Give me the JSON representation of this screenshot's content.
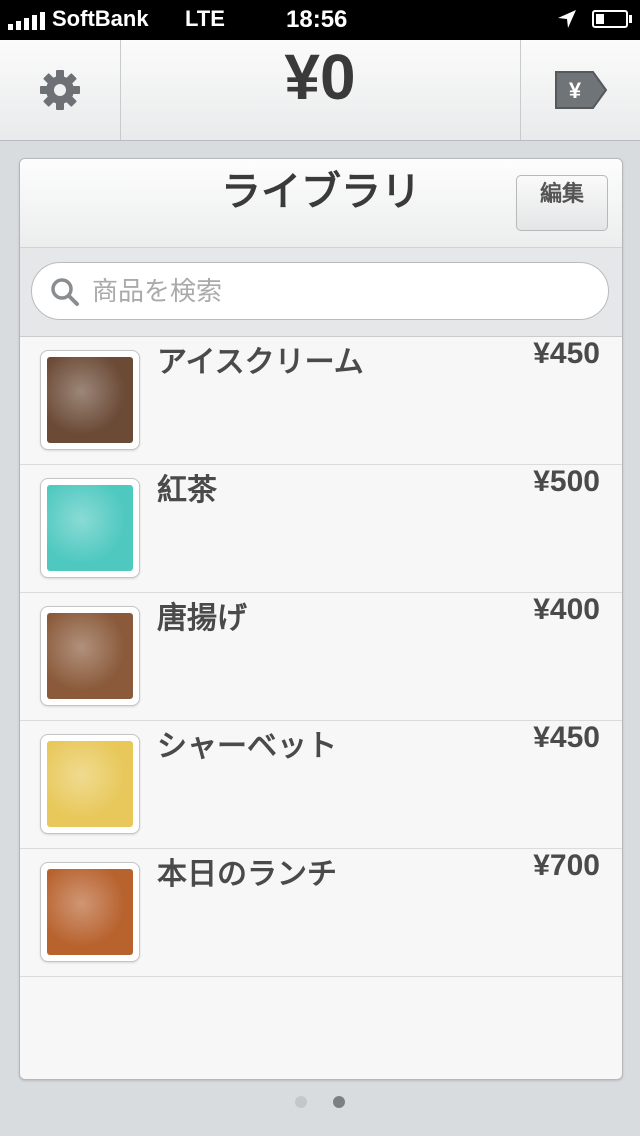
{
  "status_bar": {
    "carrier": "SoftBank",
    "network": "LTE",
    "time": "18:56"
  },
  "header": {
    "total": "¥0",
    "settings_icon": "gear-icon",
    "checkout_icon": "yen-tag-icon",
    "checkout_symbol": "¥"
  },
  "library": {
    "title": "ライブラリ",
    "edit_label": "編集",
    "search_placeholder": "商品を検索",
    "items": [
      {
        "name": "アイスクリーム",
        "price": "¥450",
        "color": "#6b4a36"
      },
      {
        "name": "紅茶",
        "price": "¥500",
        "color": "#4fc9c0"
      },
      {
        "name": "唐揚げ",
        "price": "¥400",
        "color": "#8a5a3a"
      },
      {
        "name": "シャーベット",
        "price": "¥450",
        "color": "#e8c85a"
      },
      {
        "name": "本日のランチ",
        "price": "¥700",
        "color": "#b8622e"
      }
    ]
  },
  "pager": {
    "pages": 2,
    "current": 2
  }
}
